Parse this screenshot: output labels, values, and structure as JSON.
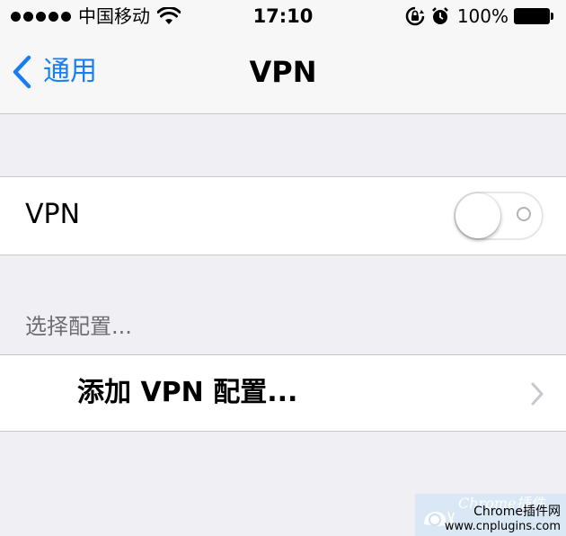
{
  "status_bar": {
    "carrier": "中国移动",
    "time": "17:10",
    "battery": "100%",
    "signal_bars": 5
  },
  "nav": {
    "back_label": "通用",
    "title": "VPN"
  },
  "vpn_row": {
    "label": "VPN",
    "enabled": false
  },
  "config_section": {
    "header": "选择配置...",
    "add_label": "添加 VPN 配置..."
  },
  "watermark": {
    "brand": "Chrome插件",
    "line1": "Chrome插件网",
    "line2": "www.cnplugins.com"
  },
  "colors": {
    "accent": "#1a7ef2",
    "background": "#efeff4",
    "separator": "#c8c7cc",
    "section_text": "#6d6d72"
  },
  "icons": {
    "wifi": "wifi-icon",
    "rotation_lock": "rotation-lock-icon",
    "alarm": "alarm-icon",
    "battery": "battery-icon",
    "back": "chevron-left-icon",
    "disclosure": "chevron-right-icon"
  }
}
